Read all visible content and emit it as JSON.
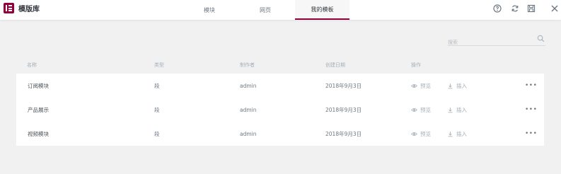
{
  "app": {
    "title": "模版库"
  },
  "tabs": [
    {
      "label": "模块"
    },
    {
      "label": "网页"
    },
    {
      "label": "我的模板",
      "active": true
    }
  ],
  "header_icons": [
    "help-icon",
    "sync-icon",
    "save-icon",
    "close-icon"
  ],
  "search": {
    "placeholder": "搜索"
  },
  "columns": {
    "name": "名称",
    "type": "类型",
    "author": "制作者",
    "date": "创建日期",
    "actions": "操作"
  },
  "rows": [
    {
      "name": "订阅模块",
      "type": "段",
      "author": "admin",
      "date": "2018年9月3日",
      "preview": "预览",
      "insert": "插入",
      "more": "•••"
    },
    {
      "name": "产品展示",
      "type": "段",
      "author": "admin",
      "date": "2018年9月3日",
      "preview": "预览",
      "insert": "插入",
      "more": "•••"
    },
    {
      "name": "视频模块",
      "type": "段",
      "author": "admin",
      "date": "2018年9月3日",
      "preview": "预览",
      "insert": "插入",
      "more": "•••"
    }
  ],
  "colors": {
    "brand": "#93003c",
    "background": "#f1f1f2",
    "text": "#6d7882"
  }
}
